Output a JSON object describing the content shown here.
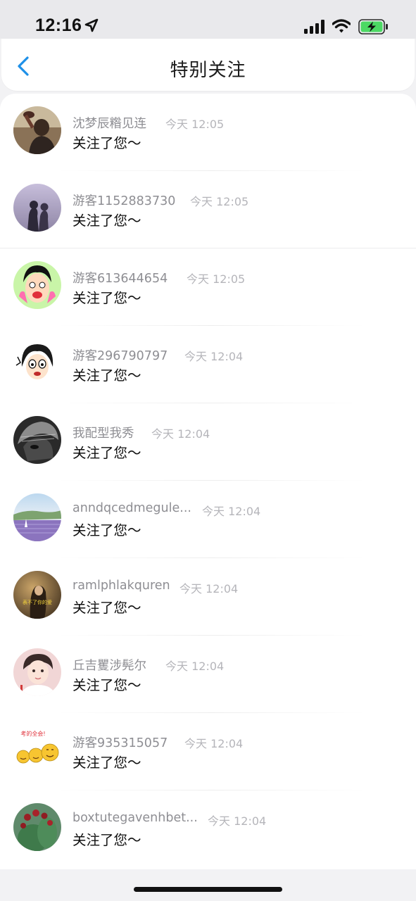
{
  "status_bar": {
    "time": "12:16"
  },
  "nav": {
    "title": "特别关注"
  },
  "list": [
    {
      "name": "沈梦辰糌见连",
      "time": "今天 12:05",
      "message": "关注了您～"
    },
    {
      "name": "游客1152883730",
      "time": "今天 12:05",
      "message": "关注了您～"
    },
    {
      "name": "游客613644654",
      "time": "今天 12:05",
      "message": "关注了您～"
    },
    {
      "name": "游客296790797",
      "time": "今天 12:04",
      "message": "关注了您～"
    },
    {
      "name": "我配型我秀",
      "time": "今天 12:04",
      "message": "关注了您～"
    },
    {
      "name": "anndqcedmegule...",
      "time": "今天 12:04",
      "message": "关注了您～"
    },
    {
      "name": "ramlphlakquren",
      "time": "今天 12:04",
      "message": "关注了您～"
    },
    {
      "name": "丘吉矍涉髡尔",
      "time": "今天 12:04",
      "message": "关注了您～"
    },
    {
      "name": "游客935315057",
      "time": "今天 12:04",
      "message": "关注了您～"
    },
    {
      "name": "boxtutegavenhbet...",
      "time": "今天 12:04",
      "message": "关注了您～"
    }
  ],
  "avatar_texts": {
    "row7": "表不了你的爱",
    "row9": "考的全会!"
  },
  "colors": {
    "accent": "#1e90e8",
    "name_gray": "#8e8e93",
    "time_gray": "#b5b5ba"
  }
}
